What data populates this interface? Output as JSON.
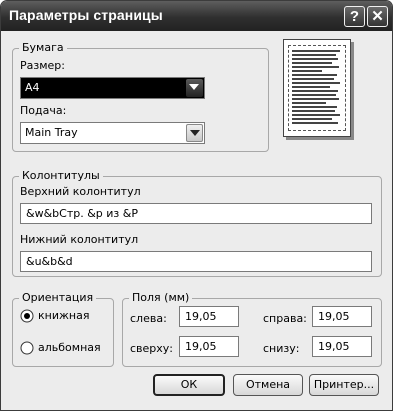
{
  "window": {
    "title": "Параметры страницы",
    "help_button": "?",
    "close_button": "✕"
  },
  "paper": {
    "legend": "Бумага",
    "size_label": "Размер:",
    "size_value": "A4",
    "source_label": "Подача:",
    "source_value": "Main Tray"
  },
  "headers": {
    "legend": "Колонтитулы",
    "header_label": "Верхний колонтитул",
    "header_value": "&w&bСтр. &p из &P",
    "footer_label": "Нижний колонтитул",
    "footer_value": "&u&b&d"
  },
  "orientation": {
    "legend": "Ориентация",
    "portrait_label": "книжная",
    "landscape_label": "альбомная",
    "selected": "portrait"
  },
  "margins": {
    "legend": "Поля (мм)",
    "left_label": "слева:",
    "left_value": "19,05",
    "right_label": "справа:",
    "right_value": "19,05",
    "top_label": "сверху:",
    "top_value": "19,05",
    "bottom_label": "снизу:",
    "bottom_value": "19,05"
  },
  "buttons": {
    "ok": "ОК",
    "cancel": "Отмена",
    "printer": "Принтер..."
  }
}
